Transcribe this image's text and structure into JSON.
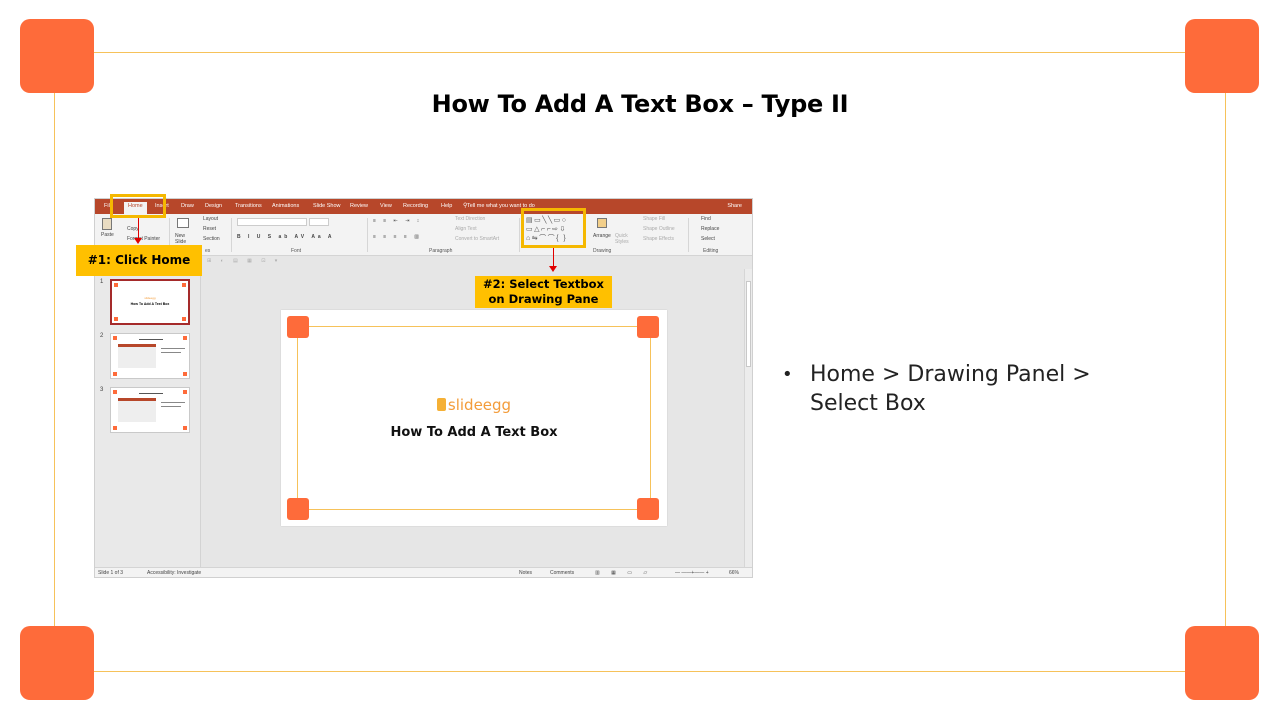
{
  "slide": {
    "title": "How To Add A Text Box – Type II",
    "bullet": "Home > Drawing Panel > Select Box",
    "colors": {
      "accent_orange": "#fe6b3a",
      "frame_line": "#f6c25a",
      "callout_yellow": "#ffc000"
    }
  },
  "screenshot": {
    "tabs": [
      "File",
      "Home",
      "Insert",
      "Draw",
      "Design",
      "Transitions",
      "Animations",
      "Slide Show",
      "Review",
      "View",
      "Recording",
      "Help"
    ],
    "active_tab": "Home",
    "tell_me": "Tell me what you want to do",
    "share": "Share",
    "ribbon": {
      "clipboard": {
        "paste": "Paste",
        "copy": "Copy",
        "format_painter": "Format Painter"
      },
      "slides": {
        "new_slide": "New Slide",
        "layout": "Layout",
        "reset": "Reset",
        "section": "Section"
      },
      "paragraph": {
        "text_direction": "Text Direction",
        "align_text": "Align Text",
        "convert_smartart": "Convert to SmartArt"
      },
      "drawing": {
        "arrange": "Arrange",
        "quick_styles": "Quick Styles",
        "shape_fill": "Shape Fill",
        "shape_outline": "Shape Outline",
        "shape_effects": "Shape Effects"
      },
      "editing": {
        "find": "Find",
        "replace": "Replace",
        "select": "Select"
      },
      "groups": {
        "font": "Font",
        "paragraph": "Paragraph",
        "drawing": "Drawing",
        "editing": "Editing",
        "slides": "es"
      }
    },
    "thumbnails": [
      {
        "num": "1",
        "title": "How To Add A Text Box"
      },
      {
        "num": "2",
        "title": ""
      },
      {
        "num": "3",
        "title": ""
      }
    ],
    "canvas": {
      "logo": "slideegg",
      "title": "How To Add A Text Box"
    },
    "status": {
      "slide_counter": "Slide 1 of 3",
      "accessibility": "Accessibility: Investigate",
      "notes": "Notes",
      "comments": "Comments",
      "zoom": "66%"
    }
  },
  "callouts": {
    "step1": "#1: Click Home",
    "step2": "#2: Select Textbox on Drawing Pane"
  }
}
